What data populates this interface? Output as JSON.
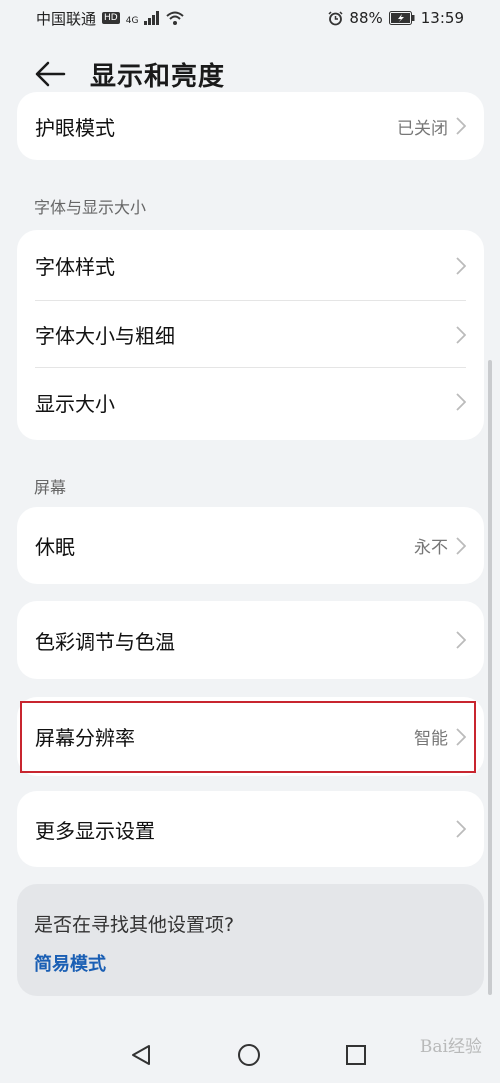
{
  "status_bar": {
    "carrier": "中国联通",
    "hd": "HD",
    "network": "4G",
    "battery": "88%",
    "time": "13:59"
  },
  "header": {
    "title": "显示和亮度"
  },
  "card_top": {
    "eye_comfort": {
      "label": "护眼模式",
      "value": "已关闭"
    }
  },
  "font_section": {
    "header": "字体与显示大小",
    "items": [
      {
        "label": "字体样式"
      },
      {
        "label": "字体大小与粗细"
      },
      {
        "label": "显示大小"
      }
    ]
  },
  "screen_section": {
    "header": "屏幕",
    "sleep": {
      "label": "休眠",
      "value": "永不"
    },
    "color": {
      "label": "色彩调节与色温"
    },
    "resolution": {
      "label": "屏幕分辨率",
      "value": "智能"
    },
    "more": {
      "label": "更多显示设置"
    }
  },
  "suggestion": {
    "title": "是否在寻找其他设置项?",
    "link": "简易模式"
  },
  "watermark": "Bai经验",
  "colors": {
    "background": "#f1f3f5",
    "card": "#ffffff",
    "highlight": "#c8252f",
    "link": "#1a5fb4"
  }
}
